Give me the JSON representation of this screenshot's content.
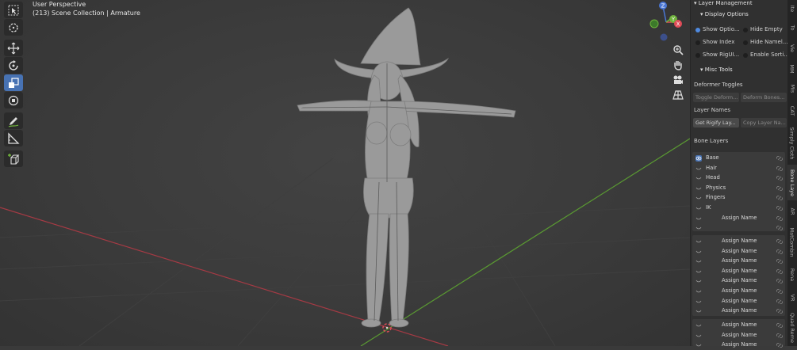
{
  "viewport": {
    "mode_label": "User Perspective",
    "collection_label": "(213) Scene Collection | Armature",
    "axis_labels": {
      "z": "Z",
      "y": "Y",
      "x": "X"
    },
    "colors": {
      "x_axis": "#e04c58",
      "y_axis": "#6fb23c",
      "z_axis": "#4a76d4"
    }
  },
  "toolbar": {
    "tools": [
      {
        "name": "select-box-tool",
        "icon": "cursor-box-icon",
        "active": false
      },
      {
        "name": "cursor-tool",
        "icon": "3d-cursor-icon",
        "active": false
      },
      {
        "name": "move-tool",
        "icon": "move-arrows-icon",
        "active": false
      },
      {
        "name": "rotate-tool",
        "icon": "rotate-icon",
        "active": false
      },
      {
        "name": "scale-tool",
        "icon": "scale-icon",
        "active": true
      },
      {
        "name": "transform-tool",
        "icon": "transform-icon",
        "active": false
      },
      {
        "name": "annotate-tool",
        "icon": "pencil-icon",
        "active": false
      },
      {
        "name": "measure-tool",
        "icon": "ruler-icon",
        "active": false
      },
      {
        "name": "add-cube-tool",
        "icon": "add-cube-icon",
        "active": false
      }
    ]
  },
  "sidebar": {
    "panel_title": "Layer Management",
    "display_options": {
      "title": "Display Options",
      "toggles": [
        {
          "label": "Show Optio...",
          "on": true
        },
        {
          "label": "Hide Empty",
          "on": false
        },
        {
          "label": "Show Index",
          "on": false
        },
        {
          "label": "Hide Namel...",
          "on": false
        },
        {
          "label": "Show RigUI...",
          "on": false
        },
        {
          "label": "Enable Sorti...",
          "on": false
        }
      ]
    },
    "misc_tools_title": "Misc Tools",
    "deformer_toggles": {
      "title": "Deformer Toggles",
      "buttons": [
        "Toggle Deform...",
        "Deform Bones..."
      ]
    },
    "layer_names": {
      "title": "Layer Names",
      "buttons": [
        "Get Rigify Lay...",
        "Copy Layer Na..."
      ]
    },
    "bone_layers": {
      "title": "Bone Layers",
      "groups": [
        [
          "Base",
          "Hair",
          "Head",
          "Physics",
          "Fingers",
          "IK",
          "Assign Name",
          ""
        ],
        [
          "Assign Name",
          "Assign Name",
          "Assign Name",
          "Assign Name",
          "Assign Name",
          "Assign Name",
          "Assign Name",
          "Assign Name"
        ],
        [
          "Assign Name",
          "Assign Name",
          "Assign Name"
        ]
      ]
    }
  },
  "tabs": [
    "Ite",
    "To",
    "Vie",
    "MM",
    "Mis",
    "CAT",
    "Simply Cloth",
    "Bone Laye",
    "AR",
    "MatCombin",
    "Rena",
    "VR",
    "Quad Reme"
  ]
}
